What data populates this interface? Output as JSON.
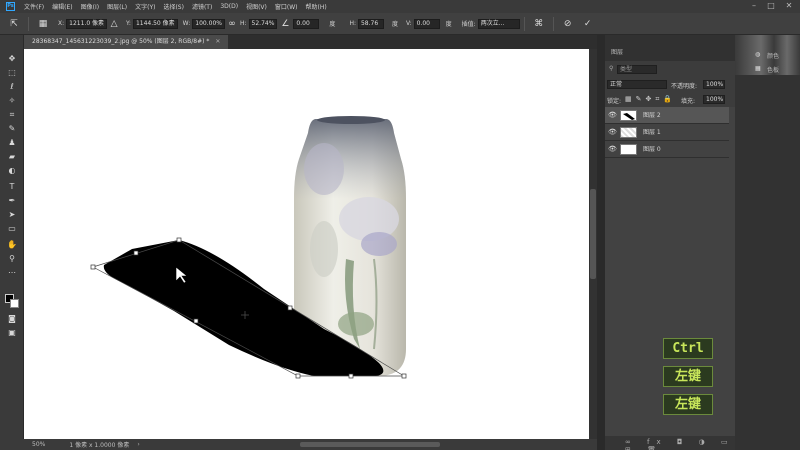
{
  "menubar": {
    "app_logo": "Ps",
    "items": [
      "文件(F)",
      "编辑(E)",
      "图像(I)",
      "图层(L)",
      "文字(Y)",
      "选择(S)",
      "滤镜(T)",
      "3D(D)",
      "视图(V)",
      "窗口(W)",
      "帮助(H)"
    ]
  },
  "options": {
    "x_label": "X:",
    "x_value": "1211.0 像素",
    "y_label": "Y:",
    "y_value": "1144.50 像素",
    "w_label": "W:",
    "w_value": "100.00%",
    "h_label": "H:",
    "h_value": "52.74%",
    "angle_value": "0.00",
    "angle_unit": "度",
    "hskew_label": "H:",
    "hskew_value": "58.76",
    "hskew_unit": "度",
    "vskew_label": "V:",
    "vskew_value": "0.00",
    "vskew_unit": "度",
    "interp_label": "插值:",
    "interp_value": "两次立..."
  },
  "document": {
    "tab_title": "28368347_145631223039_2.jpg @ 50% (图层 2, RGB/8#) *",
    "zoom": "50%",
    "status": "1 像素 x 1.0000 像素"
  },
  "layers_panel": {
    "tab_label": "图层",
    "search_placeholder": "类型",
    "blend_mode": "正常",
    "opacity_label": "不透明度:",
    "opacity_value": "100%",
    "lock_label": "锁定:",
    "fill_label": "填充:",
    "fill_value": "100%",
    "layers": [
      {
        "name": "图层 2",
        "selected": true
      },
      {
        "name": "图层 1",
        "selected": false
      },
      {
        "name": "图层 0",
        "selected": false
      }
    ]
  },
  "right_dock": {
    "items": [
      "颜色",
      "色板"
    ]
  },
  "shortcut_overlay": {
    "keys": [
      "Ctrl",
      "左键",
      "左键"
    ]
  }
}
